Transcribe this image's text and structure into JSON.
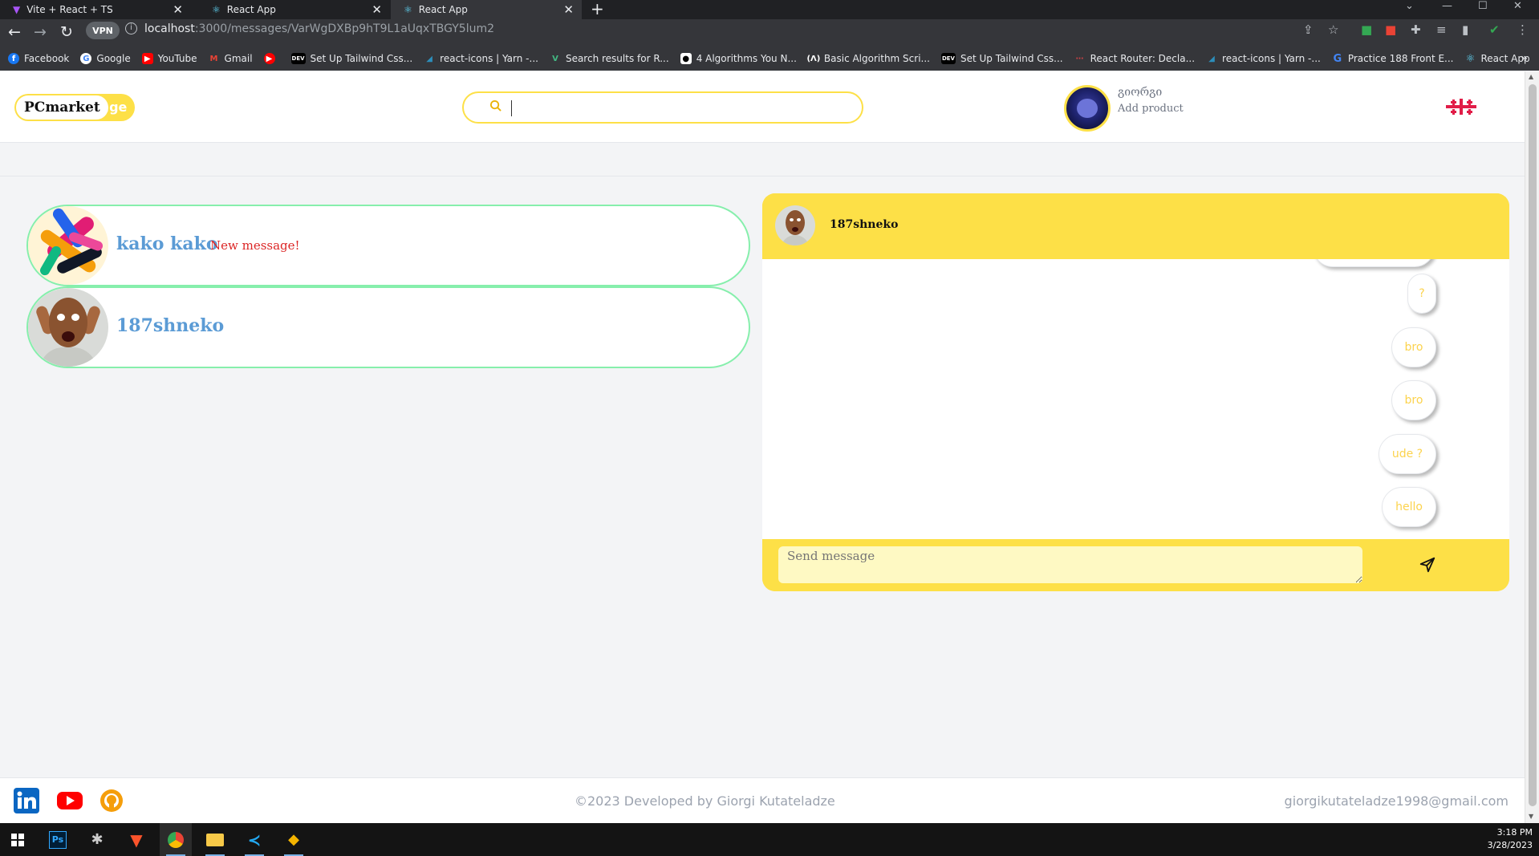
{
  "browser": {
    "tabs": [
      {
        "title": "Vite + React + TS",
        "favicon": "vite-icon",
        "active": false
      },
      {
        "title": "React App",
        "favicon": "react-icon",
        "active": false
      },
      {
        "title": "React App",
        "favicon": "react-icon",
        "active": true
      }
    ],
    "new_tab": "+",
    "vpn_label": "VPN",
    "url_host": "localhost",
    "url_path": ":3000/messages/VarWgDXBp9hT9L1aUqxTBGY5lum2",
    "bookmarks": [
      {
        "label": "Facebook",
        "icon": "facebook-icon",
        "color": "#1877f2"
      },
      {
        "label": "Google",
        "icon": "google-icon",
        "color": "#ffffff"
      },
      {
        "label": "YouTube",
        "icon": "youtube-icon",
        "color": "#ff0000"
      },
      {
        "label": "Gmail",
        "icon": "gmail-icon",
        "color": "#ea4335"
      },
      {
        "label": "",
        "icon": "youtube-icon",
        "color": "#ff0000"
      },
      {
        "label": "Set Up Tailwind Css...",
        "icon": "dev-icon",
        "color": "#000000"
      },
      {
        "label": "react-icons | Yarn -...",
        "icon": "yarn-icon",
        "color": "#2c8ebb"
      },
      {
        "label": "Search results for R...",
        "icon": "vue-icon",
        "color": "#42b883"
      },
      {
        "label": "4 Algorithms You N...",
        "icon": "medium-icon",
        "color": "#000000"
      },
      {
        "label": "Basic Algorithm Scri...",
        "icon": "freecodecamp-icon",
        "color": "#0a0a23"
      },
      {
        "label": "Set Up Tailwind Css...",
        "icon": "dev-icon",
        "color": "#000000"
      },
      {
        "label": "React Router: Decla...",
        "icon": "react-router-icon",
        "color": "#ca4245"
      },
      {
        "label": "react-icons | Yarn -...",
        "icon": "yarn-icon",
        "color": "#2c8ebb"
      },
      {
        "label": "Practice 188 Front E...",
        "icon": "g-icon",
        "color": "#4285f4"
      },
      {
        "label": "React App",
        "icon": "react-icon",
        "color": "#61dafb"
      }
    ]
  },
  "header": {
    "logo_main": "PCmarket",
    "logo_suffix": ".ge",
    "search_placeholder": "",
    "user_name": "გიორგი",
    "add_product": "Add product"
  },
  "conversations": [
    {
      "name": "kako kako",
      "badge": "New message!",
      "avatar": "abstract-art-avatar"
    },
    {
      "name": "187shneko",
      "badge": "",
      "avatar": "shocked-man-avatar"
    }
  ],
  "chat": {
    "title": "187shneko",
    "messages": [
      "?",
      "bro",
      "bro",
      "ude ?",
      "hello"
    ],
    "input_placeholder": "Send message",
    "accent_color": "#fde047"
  },
  "footer": {
    "copyright": "©2023 Developed by Giorgi Kutateladze",
    "email": "giorgikutateladze1998@gmail.com",
    "social": [
      "linkedin-icon",
      "youtube-icon",
      "github-icon"
    ]
  },
  "taskbar": {
    "time": "3:18 PM",
    "date": "3/28/2023"
  }
}
